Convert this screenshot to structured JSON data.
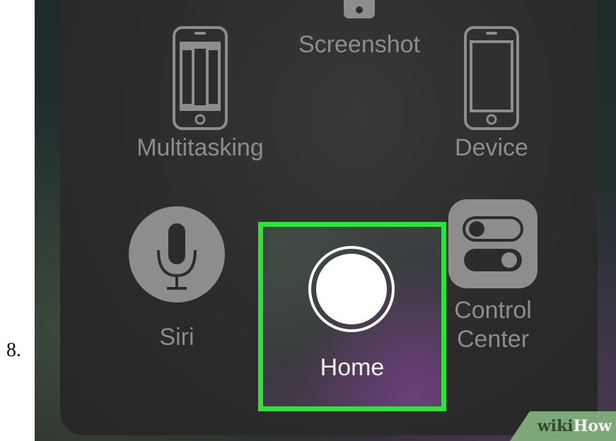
{
  "step": {
    "number": "8."
  },
  "assistive_touch_menu": {
    "items": {
      "screenshot": {
        "label": "Screenshot",
        "icon": "screenshot-icon"
      },
      "multitasking": {
        "label": "Multitasking",
        "icon": "multitasking-icon"
      },
      "device": {
        "label": "Device",
        "icon": "device-icon"
      },
      "siri": {
        "label": "Siri",
        "icon": "microphone-icon"
      },
      "control_center": {
        "label_line1": "Control",
        "label_line2": "Center",
        "icon": "toggle-switches-icon"
      },
      "home": {
        "label": "Home",
        "icon": "home-circle-icon"
      }
    },
    "highlight_color": "#31e03a",
    "icon_color": "#8d8d8d"
  },
  "watermark": {
    "part1": "wiki",
    "part2": "How"
  }
}
